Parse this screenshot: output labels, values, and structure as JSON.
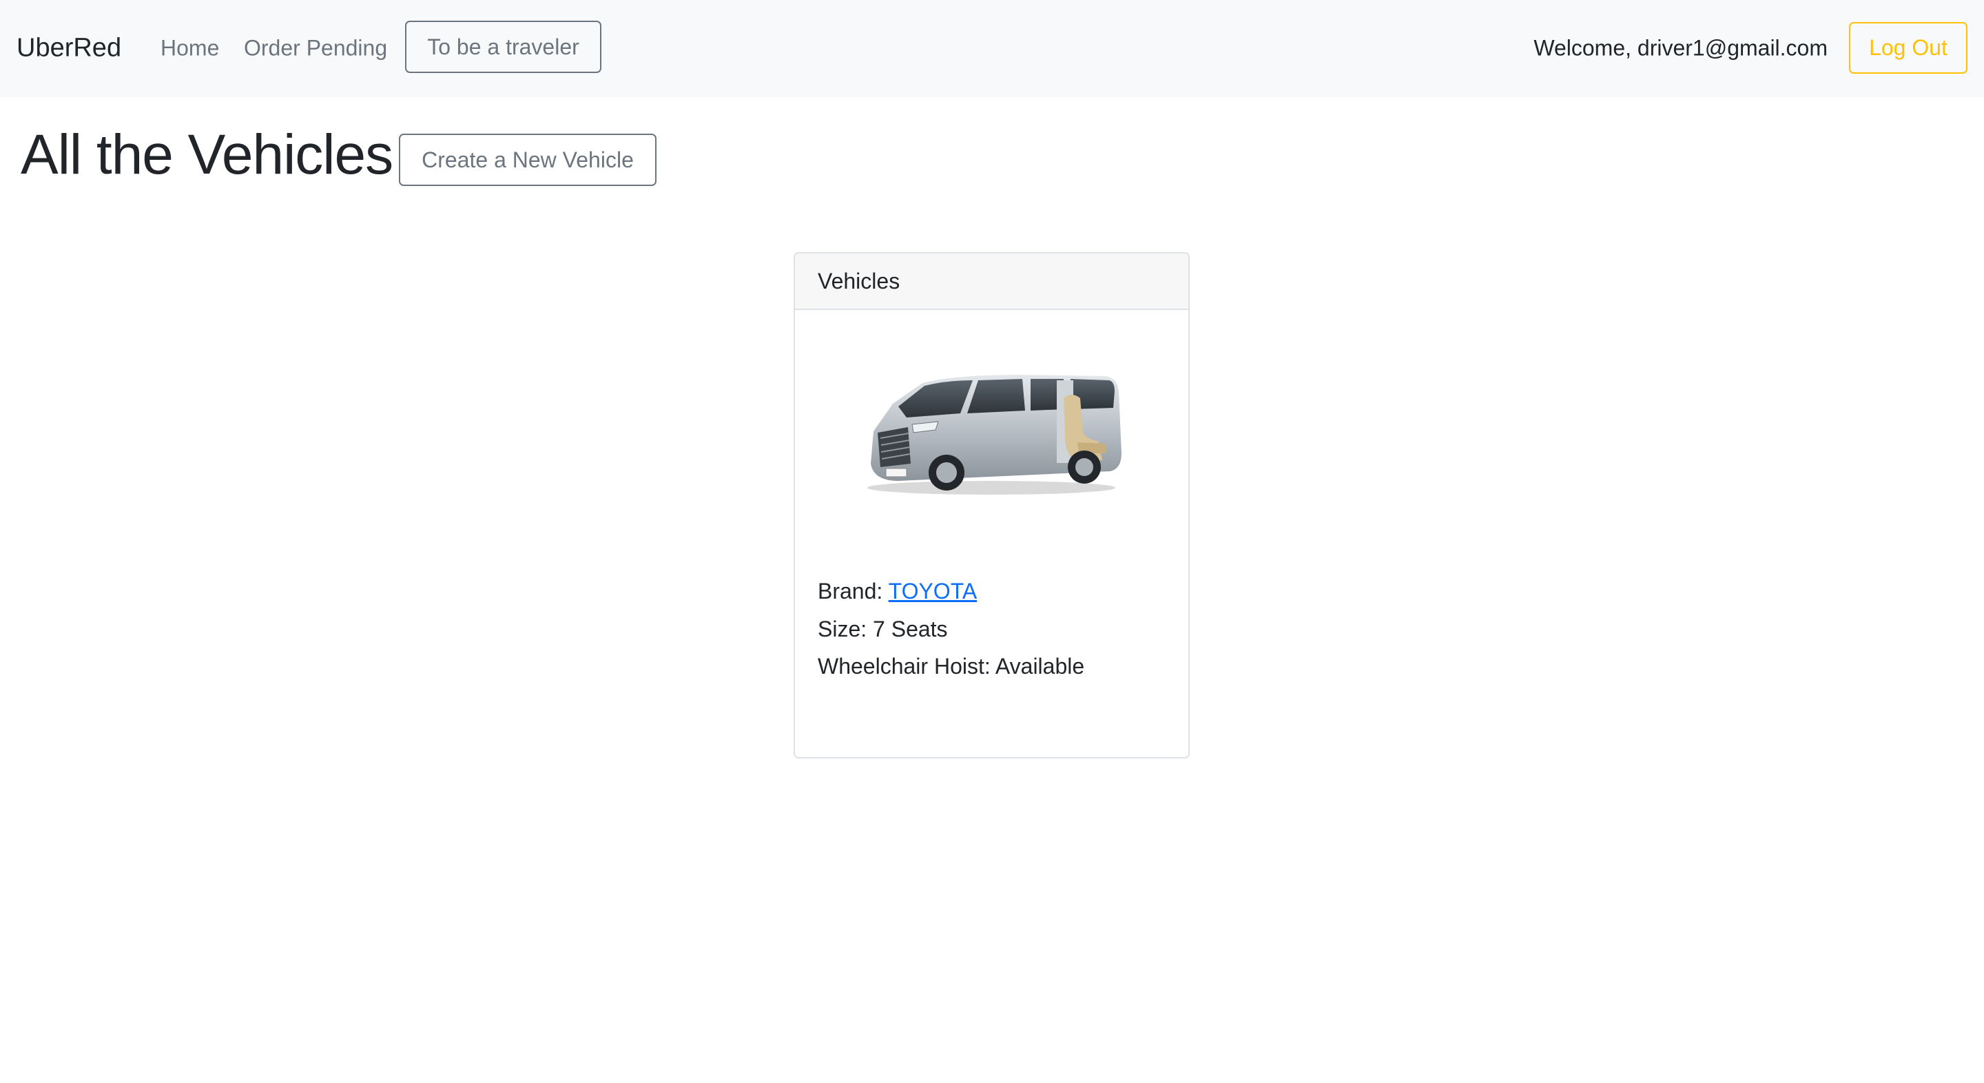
{
  "navbar": {
    "brand": "UberRed",
    "links": [
      "Home",
      "Order Pending"
    ],
    "traveler_button": "To be a traveler",
    "welcome": "Welcome, driver1@gmail.com",
    "logout_button": "Log Out"
  },
  "header": {
    "title": "All the Vehicles",
    "create_button": "Create a New Vehicle"
  },
  "card": {
    "header": "Vehicles",
    "brand_label": "Brand: ",
    "brand_value": "TOYOTA",
    "size_line": "Size: 7 Seats",
    "hoist_line": "Wheelchair Hoist: Available"
  },
  "colors": {
    "navbar_bg": "#f8f9fa",
    "secondary": "#6c757d",
    "warning": "#ffc107",
    "link": "#0d6efd"
  }
}
